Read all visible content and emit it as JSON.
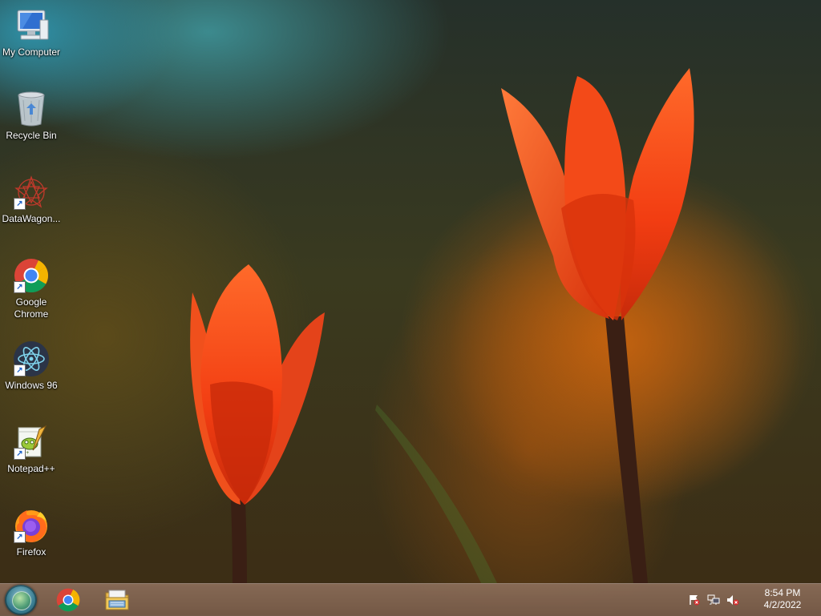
{
  "desktop": {
    "icons": [
      {
        "label": "My Computer",
        "icon": "computer-icon"
      },
      {
        "label": "Recycle Bin",
        "icon": "recycle-bin-icon"
      },
      {
        "label": "DataWagon...",
        "icon": "datawagon-icon"
      },
      {
        "label": "Google Chrome",
        "icon": "chrome-icon"
      },
      {
        "label": "Windows 96",
        "icon": "windows96-icon"
      },
      {
        "label": "Notepad++",
        "icon": "notepadpp-icon"
      },
      {
        "label": "Firefox",
        "icon": "firefox-icon"
      }
    ]
  },
  "taskbar": {
    "start": "start-button",
    "pinned": [
      {
        "icon": "chrome-icon"
      },
      {
        "icon": "file-explorer-icon"
      }
    ],
    "tray": {
      "icons": [
        "action-center-flag-icon",
        "network-icon",
        "volume-muted-icon"
      ],
      "time": "8:54 PM",
      "date": "4/2/2022"
    }
  },
  "colors": {
    "taskbar": "#7f6453",
    "label_text": "#ffffff",
    "tulip": "#e8401a"
  }
}
